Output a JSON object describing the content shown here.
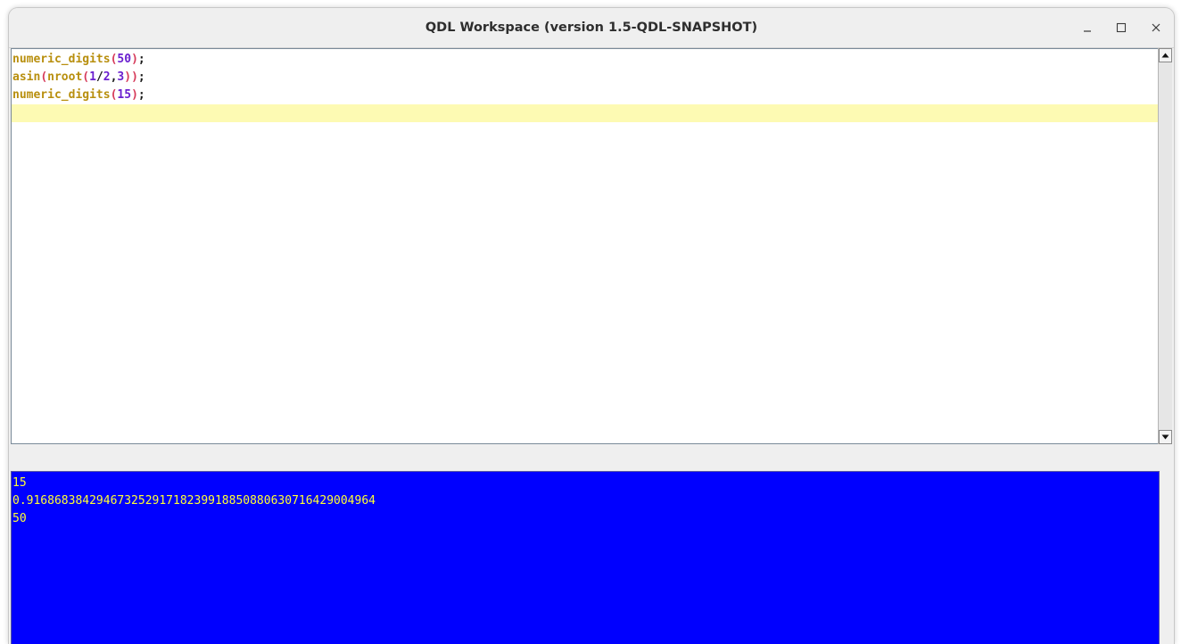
{
  "window": {
    "title": "QDL Workspace (version 1.5-QDL-SNAPSHOT)",
    "controls": [
      "minimize-icon",
      "maximize-icon",
      "close-icon"
    ]
  },
  "editor": {
    "lines": [
      {
        "fn": "numeric_digits",
        "open": "(",
        "args": "50",
        "close": ")",
        "end": ";"
      },
      {
        "fn": "asin",
        "open": "(",
        "inner_fn": "nroot",
        "inner_open": "(",
        "a": "1",
        "slash": "/",
        "b": "2",
        "comma": ",",
        "c": "3",
        "inner_close": ")",
        "close": ")",
        "end": ";"
      },
      {
        "fn": "numeric_digits",
        "open": "(",
        "args": "15",
        "close": ")",
        "end": ";"
      }
    ],
    "current_line_highlight": "#fdfab3",
    "colors": {
      "function": "#b88f0e",
      "paren": "#d63a5a",
      "number": "#6a1fcf"
    }
  },
  "console": {
    "background": "#0000ff",
    "foreground": "#ffff33",
    "lines": [
      "15",
      "0.91686838429467325291718239918850880630716429004964",
      "50"
    ]
  }
}
